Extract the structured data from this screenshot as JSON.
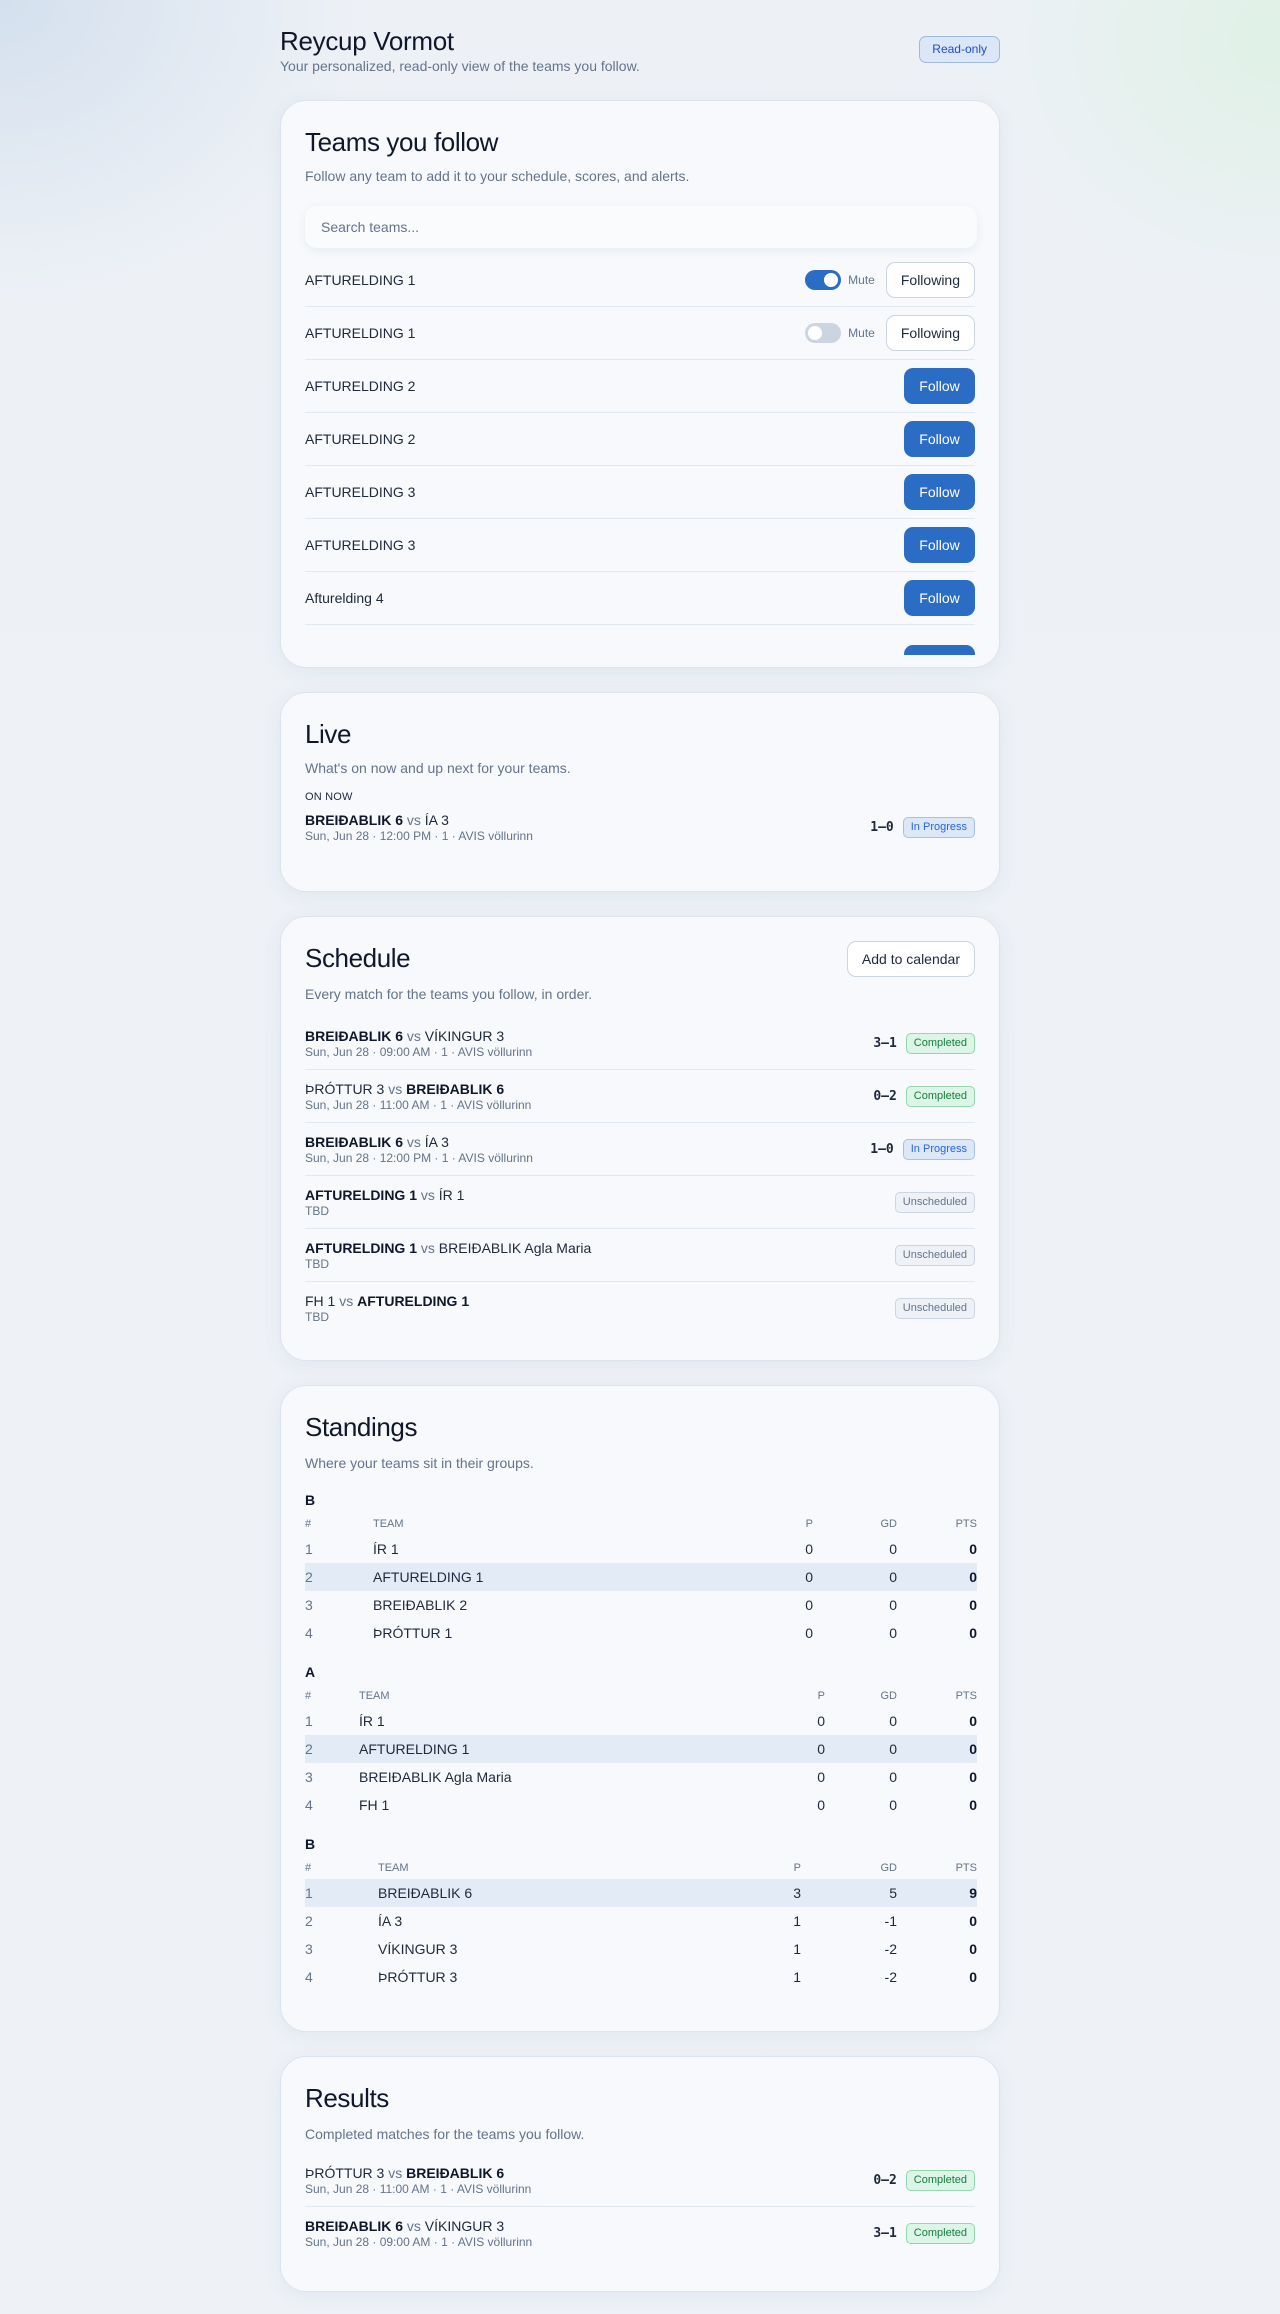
{
  "header": {
    "title": "Reycup Vormot",
    "subtitle": "Your personalized, read-only view of the teams you follow.",
    "badge": "Read-only"
  },
  "teams": {
    "title": "Teams you follow",
    "subtitle": "Follow any team to add it to your schedule, scores, and alerts.",
    "search_placeholder": "Search teams...",
    "mute_label": "Mute",
    "following_label": "Following",
    "follow_label": "Follow",
    "rows": [
      {
        "name": "AFTURELDING 1",
        "following": true,
        "muted": true
      },
      {
        "name": "AFTURELDING 1",
        "following": true,
        "muted": false
      },
      {
        "name": "AFTURELDING 2",
        "following": false
      },
      {
        "name": "AFTURELDING 2",
        "following": false
      },
      {
        "name": "AFTURELDING 3",
        "following": false
      },
      {
        "name": "AFTURELDING 3",
        "following": false
      },
      {
        "name": "Afturelding 4",
        "following": false
      }
    ]
  },
  "live": {
    "title": "Live",
    "subtitle": "What's on now and up next for your teams.",
    "section_label": "ON NOW",
    "match": {
      "home": "BREIÐABLIK 6",
      "vs": "vs",
      "away": "ÍA 3",
      "meta": "Sun, Jun 28 · 12:00 PM · 1 · AVIS völlurinn",
      "score": "1–0",
      "status": "In Progress"
    }
  },
  "schedule": {
    "title": "Schedule",
    "subtitle": "Every match for the teams you follow, in order.",
    "calendar_button": "Add to calendar",
    "matches": [
      {
        "home": "BREIÐABLIK 6",
        "vs": "vs",
        "away": "VÍKINGUR 3",
        "meta": "Sun, Jun 28 · 09:00 AM · 1 · AVIS völlurinn",
        "score": "3–1",
        "status": "Completed"
      },
      {
        "home": "ÞRÓTTUR 3",
        "vs": "vs",
        "away": "BREIÐABLIK 6",
        "meta": "Sun, Jun 28 · 11:00 AM · 1 · AVIS völlurinn",
        "score": "0–2",
        "status": "Completed"
      },
      {
        "home": "BREIÐABLIK 6",
        "vs": "vs",
        "away": "ÍA 3",
        "meta": "Sun, Jun 28 · 12:00 PM · 1 · AVIS völlurinn",
        "score": "1–0",
        "status": "In Progress"
      },
      {
        "home": "AFTURELDING 1",
        "vs": "vs",
        "away": "ÍR 1",
        "meta": "TBD",
        "status": "Unscheduled"
      },
      {
        "home": "AFTURELDING 1",
        "vs": "vs",
        "away": "BREIÐABLIK Agla Maria",
        "meta": "TBD",
        "status": "Unscheduled"
      },
      {
        "home": "FH 1",
        "vs": "vs",
        "away": "AFTURELDING 1",
        "meta": "TBD",
        "status": "Unscheduled"
      }
    ]
  },
  "standings": {
    "title": "Standings",
    "subtitle": "Where your teams sit in their groups.",
    "columns": {
      "rank": "#",
      "team": "TEAM",
      "p": "P",
      "gd": "GD",
      "pts": "PTS"
    },
    "groups": [
      {
        "name": "B",
        "rows": [
          {
            "rank": "1",
            "team": "ÍR 1",
            "p": "0",
            "gd": "0",
            "pts": "0"
          },
          {
            "rank": "2",
            "team": "AFTURELDING 1",
            "p": "0",
            "gd": "0",
            "pts": "0"
          },
          {
            "rank": "3",
            "team": "BREIÐABLIK 2",
            "p": "0",
            "gd": "0",
            "pts": "0"
          },
          {
            "rank": "4",
            "team": "ÞRÓTTUR 1",
            "p": "0",
            "gd": "0",
            "pts": "0"
          }
        ]
      },
      {
        "name": "A",
        "rows": [
          {
            "rank": "1",
            "team": "ÍR 1",
            "p": "0",
            "gd": "0",
            "pts": "0"
          },
          {
            "rank": "2",
            "team": "AFTURELDING 1",
            "p": "0",
            "gd": "0",
            "pts": "0"
          },
          {
            "rank": "3",
            "team": "BREIÐABLIK Agla Maria",
            "p": "0",
            "gd": "0",
            "pts": "0"
          },
          {
            "rank": "4",
            "team": "FH 1",
            "p": "0",
            "gd": "0",
            "pts": "0"
          }
        ]
      },
      {
        "name": "B",
        "rows": [
          {
            "rank": "1",
            "team": "BREIÐABLIK 6",
            "p": "3",
            "gd": "5",
            "pts": "9"
          },
          {
            "rank": "2",
            "team": "ÍA 3",
            "p": "1",
            "gd": "-1",
            "pts": "0"
          },
          {
            "rank": "3",
            "team": "VÍKINGUR 3",
            "p": "1",
            "gd": "-2",
            "pts": "0"
          },
          {
            "rank": "4",
            "team": "ÞRÓTTUR 3",
            "p": "1",
            "gd": "-2",
            "pts": "0"
          }
        ]
      }
    ]
  },
  "results": {
    "title": "Results",
    "subtitle": "Completed matches for the teams you follow.",
    "matches": [
      {
        "home": "ÞRÓTTUR 3",
        "vs": "vs",
        "away": "BREIÐABLIK 6",
        "meta": "Sun, Jun 28 · 11:00 AM · 1 · AVIS völlurinn",
        "score": "0–2",
        "status": "Completed"
      },
      {
        "home": "BREIÐABLIK 6",
        "vs": "vs",
        "away": "VÍKINGUR 3",
        "meta": "Sun, Jun 28 · 09:00 AM · 1 · AVIS völlurinn",
        "score": "3–1",
        "status": "Completed"
      }
    ]
  },
  "colors": {
    "accent": "#2b6cc4",
    "completed": "#15803d",
    "in_progress": "#2563eb",
    "unscheduled": "#64748b"
  }
}
